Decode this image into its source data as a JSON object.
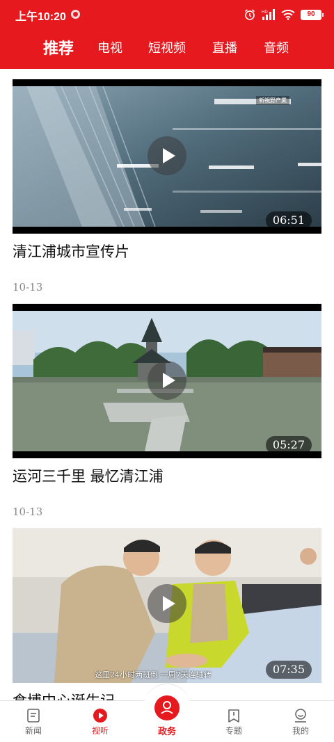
{
  "status_bar": {
    "time": "上午10:20",
    "battery": "90",
    "network": "HD"
  },
  "tabs": [
    {
      "label": "推荐",
      "active": true
    },
    {
      "label": "电视",
      "active": false
    },
    {
      "label": "短视频",
      "active": false
    },
    {
      "label": "直播",
      "active": false
    },
    {
      "label": "音频",
      "active": false
    }
  ],
  "videos": [
    {
      "title": "清江浦城市宣传片",
      "date": "10-13",
      "duration": "06:51",
      "overlay_text": "新視野产業"
    },
    {
      "title": "运河三千里  最忆清江浦",
      "date": "10-13",
      "duration": "05:27"
    },
    {
      "title": "食博中心诞生记",
      "date": "",
      "duration": "07:35",
      "subtitle": "这里24小时两班倒 一周7天连轴转"
    }
  ],
  "bottom_nav": [
    {
      "label": "新闻",
      "icon": "news-icon",
      "active": false
    },
    {
      "label": "视听",
      "icon": "play-circle-icon",
      "active": true
    },
    {
      "label": "政务",
      "icon": "government-icon",
      "active": false
    },
    {
      "label": "专题",
      "icon": "bookmark-icon",
      "active": false
    },
    {
      "label": "我的",
      "icon": "profile-icon",
      "active": false
    }
  ],
  "colors": {
    "brand_red": "#e5191e",
    "text_primary": "#111111",
    "text_secondary": "#888888"
  }
}
